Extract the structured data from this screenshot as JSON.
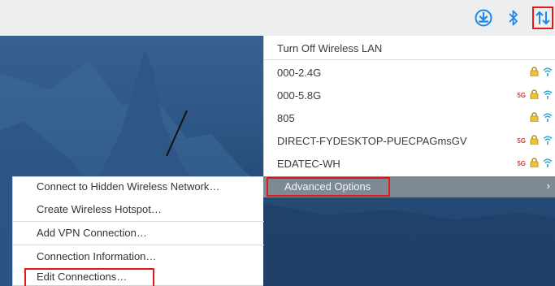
{
  "tray": {
    "icons": [
      "download-icon",
      "bluetooth-icon",
      "network-icon"
    ],
    "accent": "#1e88e5",
    "highlight": "#e01919"
  },
  "wifi_menu": {
    "turn_off_label": "Turn Off Wireless LAN",
    "networks": [
      {
        "ssid": "000-2.4G",
        "band_5g": false,
        "secured": true
      },
      {
        "ssid": "000-5.8G",
        "band_5g": true,
        "band_label": "5G",
        "secured": true
      },
      {
        "ssid": "805",
        "band_5g": false,
        "secured": true
      },
      {
        "ssid": "DIRECT-FYDESKTOP-PUECPAGmsGV",
        "band_5g": true,
        "band_label": "5G",
        "secured": true
      },
      {
        "ssid": "EDATEC-WH",
        "band_5g": true,
        "band_label": "5G",
        "secured": true
      }
    ],
    "advanced_label": "Advanced Options",
    "advanced_chevron": "›"
  },
  "advanced_menu": {
    "items": [
      "Connect to Hidden Wireless Network…",
      "Create Wireless Hotspot…",
      "Add VPN Connection…",
      "Connection Information…",
      "Edit Connections…"
    ]
  }
}
